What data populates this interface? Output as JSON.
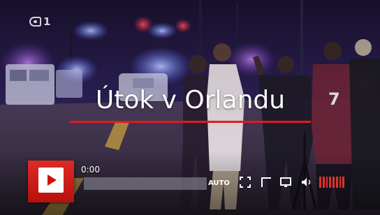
{
  "channel": {
    "logo_text": "1"
  },
  "video": {
    "title": "Útok v Orlandu",
    "scene": "night street, emergency vehicle lights, people embracing"
  },
  "player": {
    "timecode": "0:00",
    "progress": 0.0,
    "quality_label": "AUTO",
    "volume_level": 1.0,
    "volume_segments": 8,
    "icons": {
      "play": "play-icon",
      "fullscreen": "fullscreen-icon",
      "popout": "popout-icon",
      "cast": "cast-icon",
      "volume": "volume-icon"
    }
  },
  "colors": {
    "accent": "#e01b1b",
    "title_text": "#ffffff"
  }
}
